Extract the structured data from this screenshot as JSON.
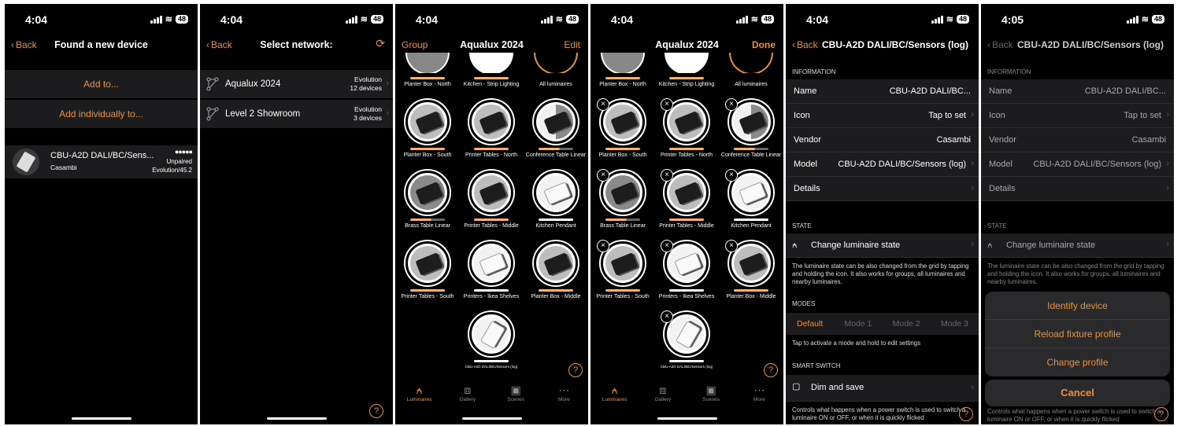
{
  "status": {
    "time1": "4:04",
    "time6": "4:05",
    "battery": "48"
  },
  "s1": {
    "back": "Back",
    "title": "Found a new device",
    "add_to": "Add to...",
    "add_individually": "Add individually to...",
    "device": {
      "name": "CBU-A2D DALI/BC/Sens...",
      "vendor": "Casambi",
      "signal": "●●●●●",
      "state": "Unpaired",
      "fw": "Evolution/45.2"
    }
  },
  "s2": {
    "back": "Back",
    "title": "Select network:",
    "networks": [
      {
        "name": "Aqualux 2024",
        "type": "Evolution",
        "count": "12 devices"
      },
      {
        "name": "Level 2 Showroom",
        "type": "Evolution",
        "count": "3 devices"
      }
    ]
  },
  "grid": {
    "title": "Aqualux 2024",
    "group": "Group",
    "edit": "Edit",
    "done": "Done",
    "top_labels": [
      "Planter Box - North",
      "Kitchen - Strip Lighting",
      "All luminaires"
    ],
    "rows": [
      [
        "Planter Box - South",
        "Printer Tables - North",
        "Conference Table Linear"
      ],
      [
        "Brass Table Linear",
        "Printer Tables - Middle",
        "Kitchen Pendant"
      ],
      [
        "Printer Tables - South",
        "Printers - Ikea Shelves",
        "Planter Box - Middle"
      ]
    ],
    "last": "CBU-A2D DALI/BC/Sensors (log)",
    "tabs": [
      "Luminaires",
      "Gallery",
      "Scenes",
      "More"
    ],
    "help": "?"
  },
  "detail": {
    "back": "Back",
    "title": "CBU-A2D DALI/BC/Sensors (log)",
    "info_header": "INFORMATION",
    "name_k": "Name",
    "name_v": "CBU-A2D DALI/BC...",
    "icon_k": "Icon",
    "icon_v": "Tap to set",
    "vendor_k": "Vendor",
    "vendor_v": "Casambi",
    "model_k": "Model",
    "model_v": "CBU-A2D DALI/BC/Sensors (log)",
    "details_k": "Details",
    "state_header": "STATE",
    "change_state": "Change luminaire state",
    "state_note": "The luminaire state can be also changed from the grid by tapping and holding the icon. It also works for groups, all luminaires and nearby luminaires.",
    "modes_header": "MODES",
    "modes": [
      "Default",
      "Mode 1",
      "Mode 2",
      "Mode 3"
    ],
    "modes_note": "Tap to activate a mode and hold to edit settings",
    "smart_header": "SMART SWITCH",
    "dim_save": "Dim and save",
    "smart_note": "Controls what happens when a power switch is used to switch a luminaire ON or OFF, or when it is quickly flicked"
  },
  "sheet": {
    "identify": "Identify device",
    "reload": "Reload fixture profile",
    "change": "Change profile",
    "cancel": "Cancel"
  }
}
